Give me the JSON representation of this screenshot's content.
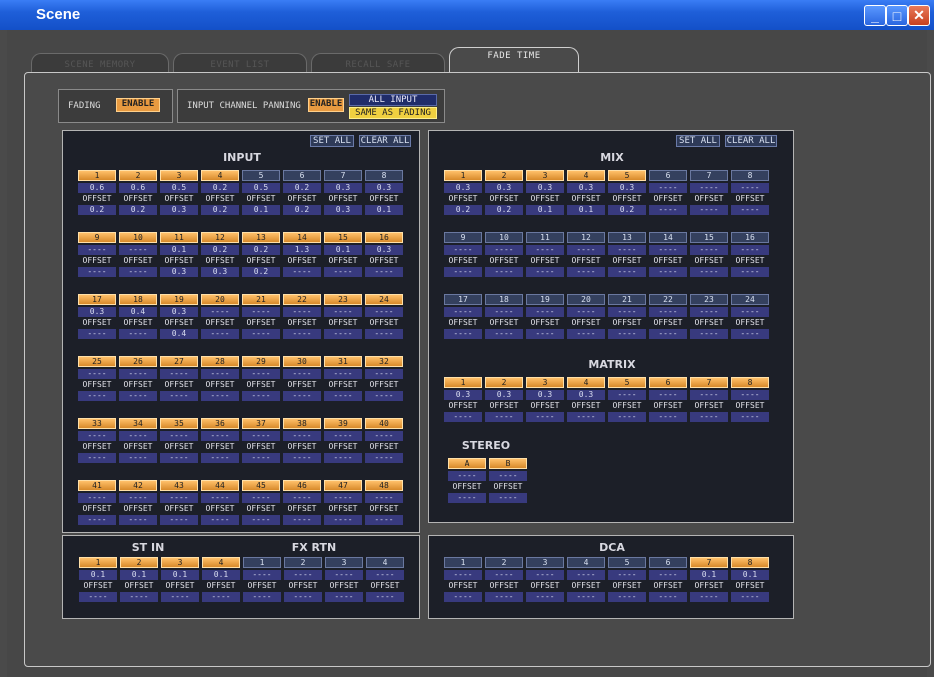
{
  "window": {
    "title": "Scene"
  },
  "tabs": [
    "SCENE MEMORY",
    "EVENT LIST",
    "RECALL SAFE",
    "FADE TIME"
  ],
  "fading": {
    "label": "FADING",
    "button": "ENABLE"
  },
  "panning": {
    "label": "INPUT CHANNEL PANNING",
    "button": "ENABLE",
    "opt1": "ALL INPUT",
    "opt2": "SAME AS FADING"
  },
  "set_all": "SET ALL",
  "clear_all": "CLEAR ALL",
  "offset_label": "OFFSET",
  "input": {
    "title": "INPUT",
    "rows": [
      {
        "ch": [
          "1",
          "2",
          "3",
          "4",
          "5",
          "6",
          "7",
          "8"
        ],
        "on": [
          1,
          1,
          1,
          1,
          0,
          0,
          0,
          0
        ],
        "fade": [
          "0.6",
          "0.6",
          "0.5",
          "0.2",
          "0.5",
          "0.2",
          "0.3",
          "0.3"
        ],
        "off": [
          "0.2",
          "0.2",
          "0.3",
          "0.2",
          "0.1",
          "0.2",
          "0.3",
          "0.1"
        ]
      },
      {
        "ch": [
          "9",
          "10",
          "11",
          "12",
          "13",
          "14",
          "15",
          "16"
        ],
        "on": [
          1,
          1,
          1,
          1,
          1,
          1,
          1,
          1
        ],
        "fade": [
          "----",
          "----",
          "0.1",
          "0.2",
          "0.2",
          "1.3",
          "0.1",
          "0.3"
        ],
        "off": [
          "----",
          "----",
          "0.3",
          "0.3",
          "0.2",
          "----",
          "----",
          "----"
        ]
      },
      {
        "ch": [
          "17",
          "18",
          "19",
          "20",
          "21",
          "22",
          "23",
          "24"
        ],
        "on": [
          1,
          1,
          1,
          1,
          1,
          1,
          1,
          1
        ],
        "fade": [
          "0.3",
          "0.4",
          "0.3",
          "----",
          "----",
          "----",
          "----",
          "----"
        ],
        "off": [
          "----",
          "----",
          "0.4",
          "----",
          "----",
          "----",
          "----",
          "----"
        ]
      },
      {
        "ch": [
          "25",
          "26",
          "27",
          "28",
          "29",
          "30",
          "31",
          "32"
        ],
        "on": [
          1,
          1,
          1,
          1,
          1,
          1,
          1,
          1
        ],
        "fade": [
          "----",
          "----",
          "----",
          "----",
          "----",
          "----",
          "----",
          "----"
        ],
        "off": [
          "----",
          "----",
          "----",
          "----",
          "----",
          "----",
          "----",
          "----"
        ]
      },
      {
        "ch": [
          "33",
          "34",
          "35",
          "36",
          "37",
          "38",
          "39",
          "40"
        ],
        "on": [
          1,
          1,
          1,
          1,
          1,
          1,
          1,
          1
        ],
        "fade": [
          "----",
          "----",
          "----",
          "----",
          "----",
          "----",
          "----",
          "----"
        ],
        "off": [
          "----",
          "----",
          "----",
          "----",
          "----",
          "----",
          "----",
          "----"
        ]
      },
      {
        "ch": [
          "41",
          "42",
          "43",
          "44",
          "45",
          "46",
          "47",
          "48"
        ],
        "on": [
          1,
          1,
          1,
          1,
          1,
          1,
          1,
          1
        ],
        "fade": [
          "----",
          "----",
          "----",
          "----",
          "----",
          "----",
          "----",
          "----"
        ],
        "off": [
          "----",
          "----",
          "----",
          "----",
          "----",
          "----",
          "----",
          "----"
        ]
      }
    ]
  },
  "mix": {
    "title": "MIX",
    "rows": [
      {
        "ch": [
          "1",
          "2",
          "3",
          "4",
          "5",
          "6",
          "7",
          "8"
        ],
        "on": [
          1,
          1,
          1,
          1,
          1,
          0,
          0,
          0
        ],
        "fade": [
          "0.3",
          "0.3",
          "0.3",
          "0.3",
          "0.3",
          "----",
          "----",
          "----"
        ],
        "off": [
          "0.2",
          "0.2",
          "0.1",
          "0.1",
          "0.2",
          "----",
          "----",
          "----"
        ]
      },
      {
        "ch": [
          "9",
          "10",
          "11",
          "12",
          "13",
          "14",
          "15",
          "16"
        ],
        "on": [
          0,
          0,
          0,
          0,
          0,
          0,
          0,
          0
        ],
        "fade": [
          "----",
          "----",
          "----",
          "----",
          "----",
          "----",
          "----",
          "----"
        ],
        "off": [
          "----",
          "----",
          "----",
          "----",
          "----",
          "----",
          "----",
          "----"
        ]
      },
      {
        "ch": [
          "17",
          "18",
          "19",
          "20",
          "21",
          "22",
          "23",
          "24"
        ],
        "on": [
          0,
          0,
          0,
          0,
          0,
          0,
          0,
          0
        ],
        "fade": [
          "----",
          "----",
          "----",
          "----",
          "----",
          "----",
          "----",
          "----"
        ],
        "off": [
          "----",
          "----",
          "----",
          "----",
          "----",
          "----",
          "----",
          "----"
        ]
      }
    ]
  },
  "matrix": {
    "title": "MATRIX",
    "rows": [
      {
        "ch": [
          "1",
          "2",
          "3",
          "4",
          "5",
          "6",
          "7",
          "8"
        ],
        "on": [
          1,
          1,
          1,
          1,
          1,
          1,
          1,
          1
        ],
        "fade": [
          "0.3",
          "0.3",
          "0.3",
          "0.3",
          "----",
          "----",
          "----",
          "----"
        ],
        "off": [
          "----",
          "----",
          "----",
          "----",
          "----",
          "----",
          "----",
          "----"
        ]
      }
    ]
  },
  "stereo": {
    "title": "STEREO",
    "rows": [
      {
        "ch": [
          "A",
          "B"
        ],
        "on": [
          1,
          1
        ],
        "fade": [
          "----",
          "----"
        ],
        "off": [
          "----",
          "----"
        ]
      }
    ]
  },
  "stin": {
    "title": "ST IN",
    "rows": [
      {
        "ch": [
          "1",
          "2",
          "3",
          "4"
        ],
        "on": [
          1,
          1,
          1,
          1
        ],
        "fade": [
          "0.1",
          "0.1",
          "0.1",
          "0.1"
        ],
        "off": [
          "----",
          "----",
          "----",
          "----"
        ]
      }
    ]
  },
  "fxrtn": {
    "title": "FX RTN",
    "rows": [
      {
        "ch": [
          "1",
          "2",
          "3",
          "4"
        ],
        "on": [
          0,
          0,
          0,
          0
        ],
        "fade": [
          "----",
          "----",
          "----",
          "----"
        ],
        "off": [
          "----",
          "----",
          "----",
          "----"
        ]
      }
    ]
  },
  "dca": {
    "title": "DCA",
    "rows": [
      {
        "ch": [
          "1",
          "2",
          "3",
          "4",
          "5",
          "6",
          "7",
          "8"
        ],
        "on": [
          0,
          0,
          0,
          0,
          0,
          0,
          1,
          1
        ],
        "fade": [
          "----",
          "----",
          "----",
          "----",
          "----",
          "----",
          "0.1",
          "0.1"
        ],
        "off": [
          "----",
          "----",
          "----",
          "----",
          "----",
          "----",
          "----",
          "----"
        ]
      }
    ]
  }
}
